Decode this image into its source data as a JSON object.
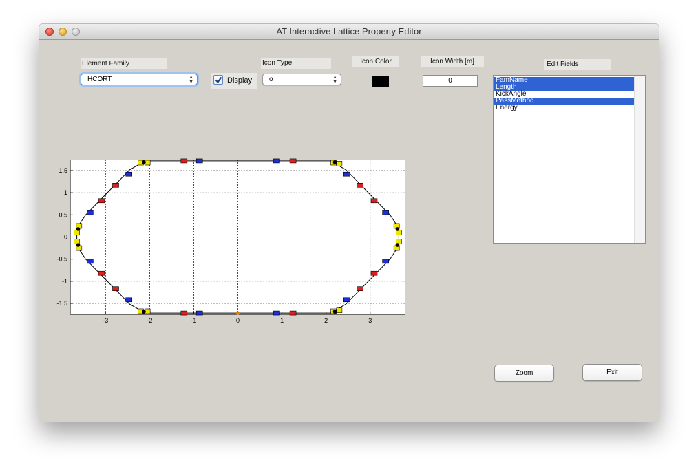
{
  "window": {
    "title": "AT Interactive Lattice Property Editor"
  },
  "controls": {
    "element_family_label": "Element Family",
    "element_family_value": "HCORT",
    "display_label": "Display",
    "display_checked": true,
    "icon_type_label": "Icon Type",
    "icon_type_value": "o",
    "icon_color_label": "Icon Color",
    "icon_color": "#000000",
    "icon_width_label": "Icon Width [m]",
    "icon_width_value": "0",
    "edit_fields_label": "Edit Fields"
  },
  "edit_fields": [
    {
      "label": "FamName",
      "selected": true
    },
    {
      "label": "Length",
      "selected": true
    },
    {
      "label": "KickAngle",
      "selected": false
    },
    {
      "label": "PassMethod",
      "selected": true
    },
    {
      "label": "Energy",
      "selected": false
    }
  ],
  "buttons": {
    "zoom": "Zoom",
    "exit": "Exit"
  },
  "chart_data": {
    "type": "scatter",
    "title": "",
    "xlabel": "",
    "ylabel": "",
    "xlim": [
      -3.8,
      3.8
    ],
    "ylim": [
      -1.75,
      1.75
    ],
    "x_ticks": [
      -3,
      -2,
      -1,
      0,
      1,
      2,
      3
    ],
    "y_ticks": [
      -1.5,
      -1,
      -0.5,
      0,
      0.5,
      1,
      1.5
    ],
    "grid": true,
    "ring_outline": [
      [
        -2.1,
        1.72
      ],
      [
        2.1,
        1.72
      ],
      [
        2.45,
        1.52
      ],
      [
        3.45,
        0.5
      ],
      [
        3.65,
        0.2
      ],
      [
        3.65,
        -0.2
      ],
      [
        3.45,
        -0.5
      ],
      [
        2.45,
        -1.52
      ],
      [
        2.1,
        -1.72
      ],
      [
        -2.1,
        -1.72
      ],
      [
        -2.45,
        -1.52
      ],
      [
        -3.45,
        -0.5
      ],
      [
        -3.65,
        -0.2
      ],
      [
        -3.65,
        0.2
      ],
      [
        -3.45,
        0.5
      ],
      [
        -2.45,
        1.52
      ]
    ],
    "series": [
      {
        "color": "#dd1f1f",
        "points": [
          [
            -1.22,
            1.72
          ],
          [
            1.25,
            1.72
          ],
          [
            -1.22,
            -1.72
          ],
          [
            1.25,
            -1.72
          ],
          [
            -2.77,
            1.17
          ],
          [
            2.77,
            1.17
          ],
          [
            -3.09,
            0.82
          ],
          [
            3.09,
            0.82
          ],
          [
            -2.77,
            -1.17
          ],
          [
            2.77,
            -1.17
          ],
          [
            -3.09,
            -0.82
          ],
          [
            3.09,
            -0.82
          ]
        ]
      },
      {
        "color": "#1f2fd8",
        "points": [
          [
            -0.87,
            1.72
          ],
          [
            0.88,
            1.72
          ],
          [
            -0.87,
            -1.72
          ],
          [
            0.88,
            -1.72
          ],
          [
            -2.47,
            1.42
          ],
          [
            2.47,
            1.42
          ],
          [
            -3.35,
            0.55
          ],
          [
            3.35,
            0.55
          ],
          [
            -2.47,
            -1.42
          ],
          [
            2.47,
            -1.42
          ],
          [
            -3.35,
            -0.55
          ],
          [
            3.35,
            -0.55
          ]
        ]
      },
      {
        "color": "#f2e600",
        "points": [
          [
            -2.2,
            1.68
          ],
          [
            -2.05,
            1.68
          ],
          [
            2.17,
            1.68
          ],
          [
            2.3,
            1.66
          ],
          [
            -3.6,
            0.25
          ],
          [
            -3.65,
            0.1
          ],
          [
            3.6,
            0.25
          ],
          [
            3.65,
            0.1
          ],
          [
            -2.2,
            -1.68
          ],
          [
            -2.05,
            -1.68
          ],
          [
            2.17,
            -1.68
          ],
          [
            2.3,
            -1.66
          ],
          [
            -3.6,
            -0.25
          ],
          [
            -3.65,
            -0.1
          ],
          [
            3.6,
            -0.25
          ],
          [
            3.65,
            -0.1
          ]
        ]
      },
      {
        "color": "#000000",
        "points": [
          [
            -2.13,
            1.69
          ],
          [
            2.2,
            1.69
          ],
          [
            -3.62,
            0.18
          ],
          [
            3.62,
            0.18
          ],
          [
            -2.13,
            -1.69
          ],
          [
            2.2,
            -1.69
          ],
          [
            -3.62,
            -0.18
          ],
          [
            3.62,
            -0.18
          ]
        ]
      },
      {
        "color": "#e87b00",
        "points": [
          [
            0.0,
            -1.72
          ]
        ]
      }
    ]
  }
}
